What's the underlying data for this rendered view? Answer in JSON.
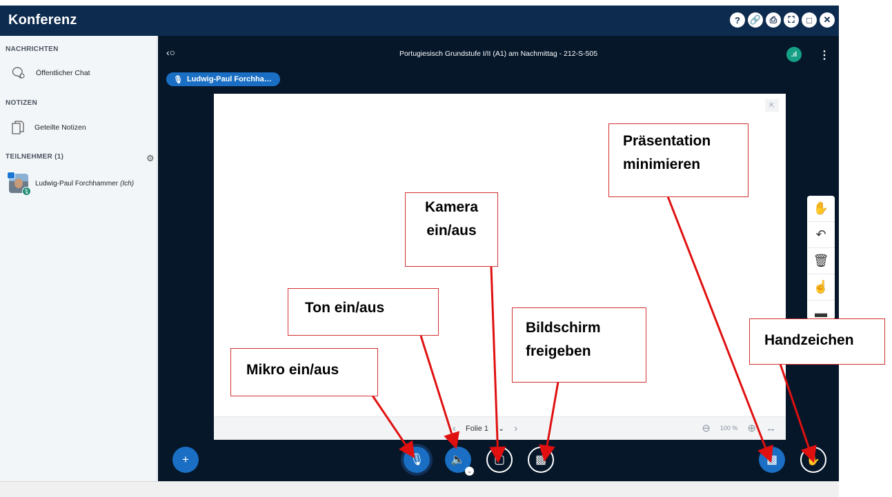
{
  "app": {
    "title": "Konferenz"
  },
  "window_icons": [
    "help-icon",
    "link-icon",
    "print-icon",
    "fullscreen-icon",
    "window-icon",
    "close-icon"
  ],
  "sidebar": {
    "messages_title": "NACHRICHTEN",
    "public_chat": "Öffentlicher Chat",
    "notes_title": "NOTIZEN",
    "shared_notes": "Geteilte Notizen",
    "participants_title": "TEILNEHMER (1)",
    "participant_name": "Ludwig-Paul Forchhammer",
    "participant_self": "(Ich)"
  },
  "main": {
    "session_title": "Portugiesisch Grundstufe I/II (A1) am Nachmittag - 212-S-505",
    "talking_indicator": "Ludwig-Paul Forchha…"
  },
  "slide": {
    "page_label": "Folie 1",
    "zoom": "100 %"
  },
  "annotations": {
    "camera": "Kamera ein/aus",
    "present_min": "Präsentation minimieren",
    "audio": "Ton ein/aus",
    "screen_share": "Bildschirm freigeben",
    "raise_hand": "Handzeichen",
    "mic": "Mikro ein/aus"
  },
  "colors": {
    "header_bg": "#0d2b4e",
    "main_bg": "#06172a",
    "accent": "#1a6fc4",
    "callout_border": "#d32f2f"
  }
}
